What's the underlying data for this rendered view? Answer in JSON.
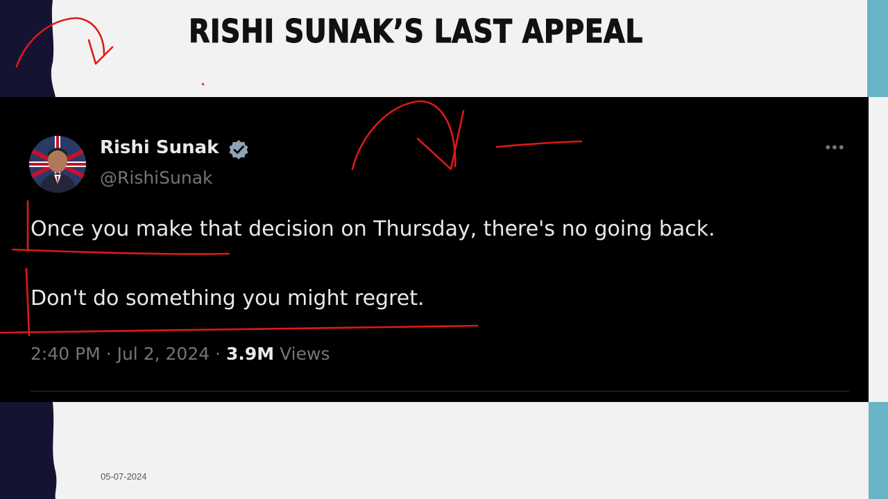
{
  "slide": {
    "title": "RISHI SUNAK’S LAST APPEAL",
    "date": "05-07-2024"
  },
  "tweet": {
    "author_name": "Rishi Sunak",
    "handle": "@RishiSunak",
    "verified": true,
    "lines": [
      "Once you make that decision on Thursday, there's no going back.",
      "Don't do something you might regret."
    ],
    "time": "2:40 PM",
    "date": "Jul 2, 2024",
    "separator": "·",
    "views_count": "3.9M",
    "views_label": "Views",
    "more_icon": "more-horizontal-icon"
  },
  "colors": {
    "panel_bg": "#000000",
    "annotation_red": "#e01818",
    "verified_badge": "#8fa3b8",
    "accent_teal": "#6ab4c8",
    "accent_navy": "#141432"
  }
}
